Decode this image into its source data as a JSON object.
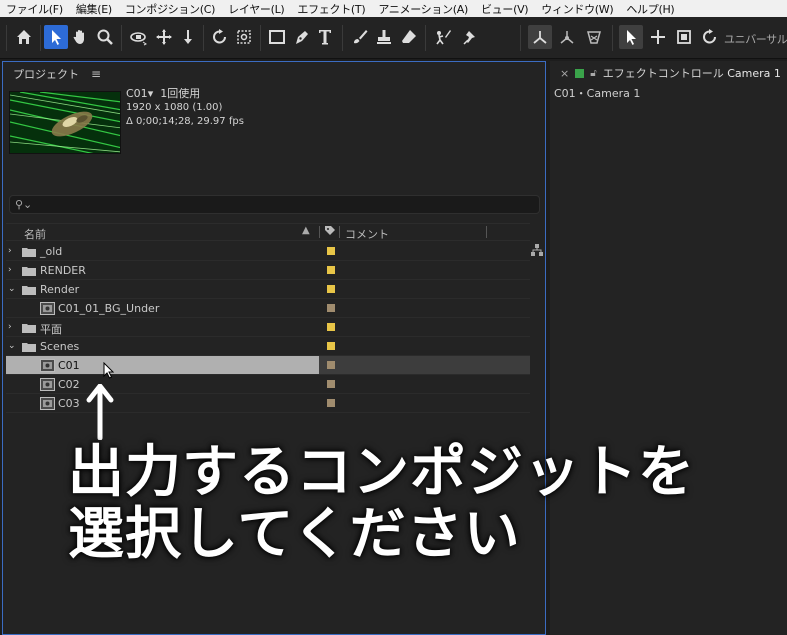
{
  "menu": [
    "ファイル(F)",
    "編集(E)",
    "コンポジション(C)",
    "レイヤー(L)",
    "エフェクト(T)",
    "アニメーション(A)",
    "ビュー(V)",
    "ウィンドウ(W)",
    "ヘルプ(H)"
  ],
  "toolbar": {
    "tools": [
      "home-icon",
      "selection-tool-icon",
      "hand-tool-icon",
      "zoom-tool-icon",
      "orbit-camera-icon",
      "pan-camera-icon",
      "dolly-camera-icon",
      "rotate-tool-icon",
      "pan-behind-icon",
      "rectangle-tool-icon",
      "pen-tool-icon",
      "type-tool-icon",
      "brush-tool-icon",
      "clone-stamp-icon",
      "eraser-tool-icon",
      "roto-brush-icon",
      "puppet-pin-icon"
    ],
    "universal_label": "ユニバーサル"
  },
  "project_panel": {
    "title": "プロジェクト",
    "selected_item": {
      "name": "C01",
      "usage": "1回使用",
      "resolution": "1920 x 1080 (1.00)",
      "duration": "Δ 0;00;14;28, 29.97 fps"
    },
    "search_placeholder": "",
    "columns": {
      "name": "名前",
      "comment": "コメント"
    },
    "items": [
      {
        "type": "folder",
        "label": "_old",
        "expanded": false,
        "indent": 0,
        "tag_color": "#e8c547"
      },
      {
        "type": "folder",
        "label": "RENDER",
        "expanded": false,
        "indent": 0,
        "tag_color": "#e8c547"
      },
      {
        "type": "folder",
        "label": "Render",
        "expanded": true,
        "indent": 0,
        "tag_color": "#e8c547"
      },
      {
        "type": "comp",
        "label": "C01_01_BG_Under",
        "indent": 1,
        "tag_color": "#a08c6e"
      },
      {
        "type": "folder",
        "label": "平面",
        "expanded": false,
        "indent": 0,
        "tag_color": "#e8c547"
      },
      {
        "type": "folder",
        "label": "Scenes",
        "expanded": true,
        "indent": 0,
        "tag_color": "#e8c547"
      },
      {
        "type": "comp",
        "label": "C01",
        "indent": 1,
        "tag_color": "#a08c6e",
        "selected": true
      },
      {
        "type": "comp",
        "label": "C02",
        "indent": 1,
        "tag_color": "#a08c6e"
      },
      {
        "type": "comp",
        "label": "C03",
        "indent": 1,
        "tag_color": "#a08c6e"
      }
    ]
  },
  "effect_panel": {
    "title": "エフェクトコントロール",
    "target": "Camera 1",
    "subtitle": "C01・Camera 1"
  },
  "annotation": {
    "line1": "出力するコンポジットを",
    "line2": "選択してください"
  },
  "colors": {
    "accent": "#2d6bd6",
    "folder_tag": "#e8c547",
    "comp_tag": "#a08c6e",
    "selection_row": "#b0b0b0"
  }
}
